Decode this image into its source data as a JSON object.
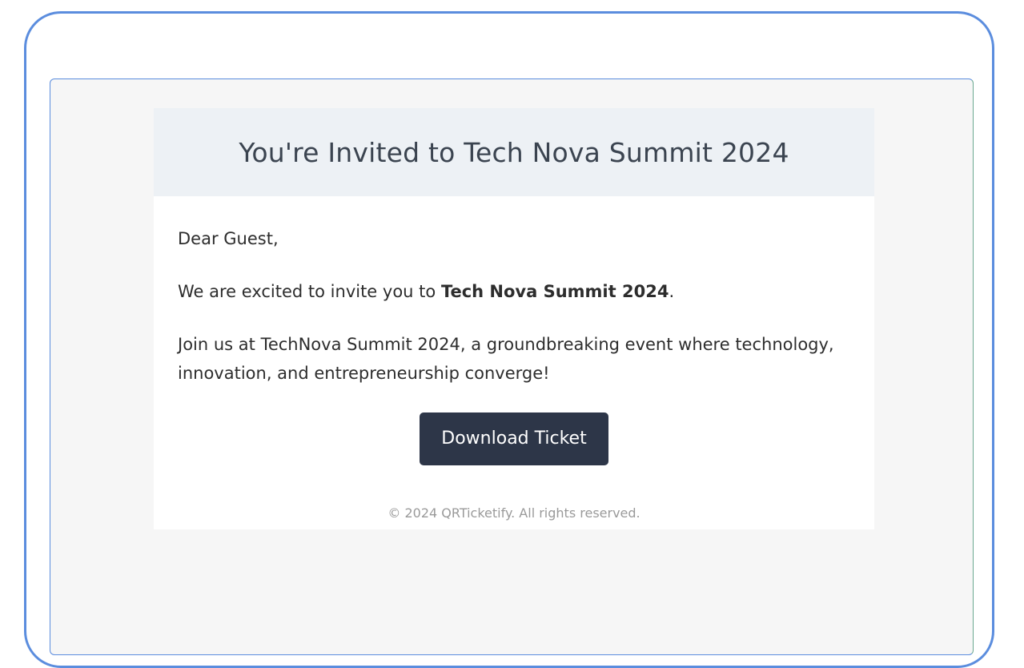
{
  "email": {
    "title": "You're Invited to Tech Nova Summit 2024",
    "greeting": "Dear Guest,",
    "invite_prefix": "We are excited to invite you to ",
    "event_name": "Tech Nova Summit 2024",
    "invite_suffix": ".",
    "description": "Join us at TechNova Summit 2024, a groundbreaking event where technology, innovation, and entrepreneurship converge!",
    "button_label": "Download Ticket",
    "footer": "© 2024 QRTicketify. All rights reserved."
  },
  "colors": {
    "frame_border": "#5b8dde",
    "header_bg": "#edf1f5",
    "button_bg": "#2d3648",
    "pane_bg": "#f6f6f6"
  }
}
